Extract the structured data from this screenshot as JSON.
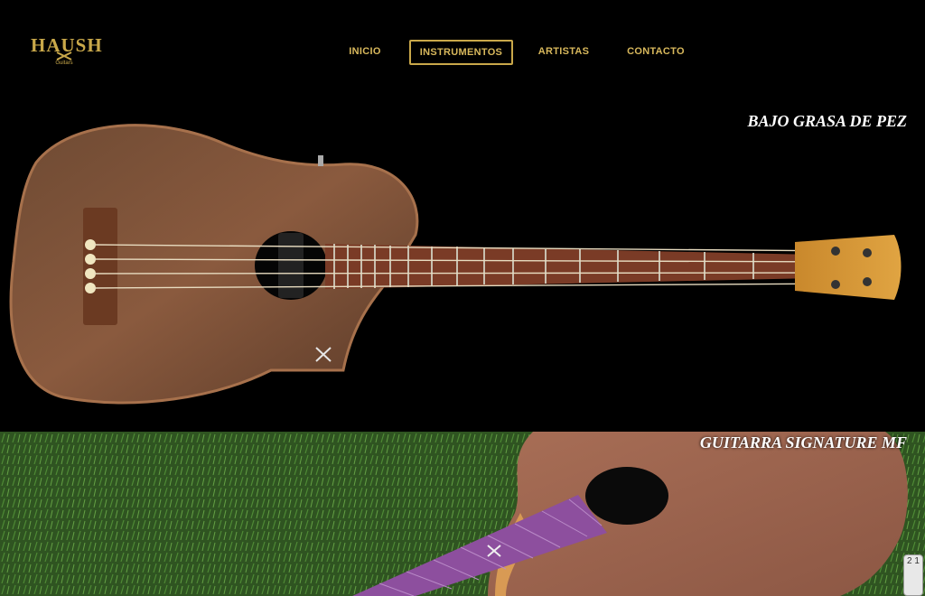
{
  "brand": {
    "name": "HAUSH",
    "sub": "Guitars"
  },
  "nav": {
    "items": [
      {
        "label": "INICIO",
        "active": false
      },
      {
        "label": "INSTRUMENTOS",
        "active": true
      },
      {
        "label": "ARTISTAS",
        "active": false
      },
      {
        "label": "CONTACTO",
        "active": false
      }
    ]
  },
  "slides": [
    {
      "title": "BAJO GRASA DE PEZ"
    },
    {
      "title": "GUITARRA SIGNATURE MF"
    }
  ],
  "widget": {
    "text": "2 1"
  },
  "colors": {
    "gold": "#c9a84a",
    "bg": "#000000",
    "wood": "#7a4a33",
    "grass": "#3b6a2a",
    "fretboard": "#8d4f9e"
  }
}
